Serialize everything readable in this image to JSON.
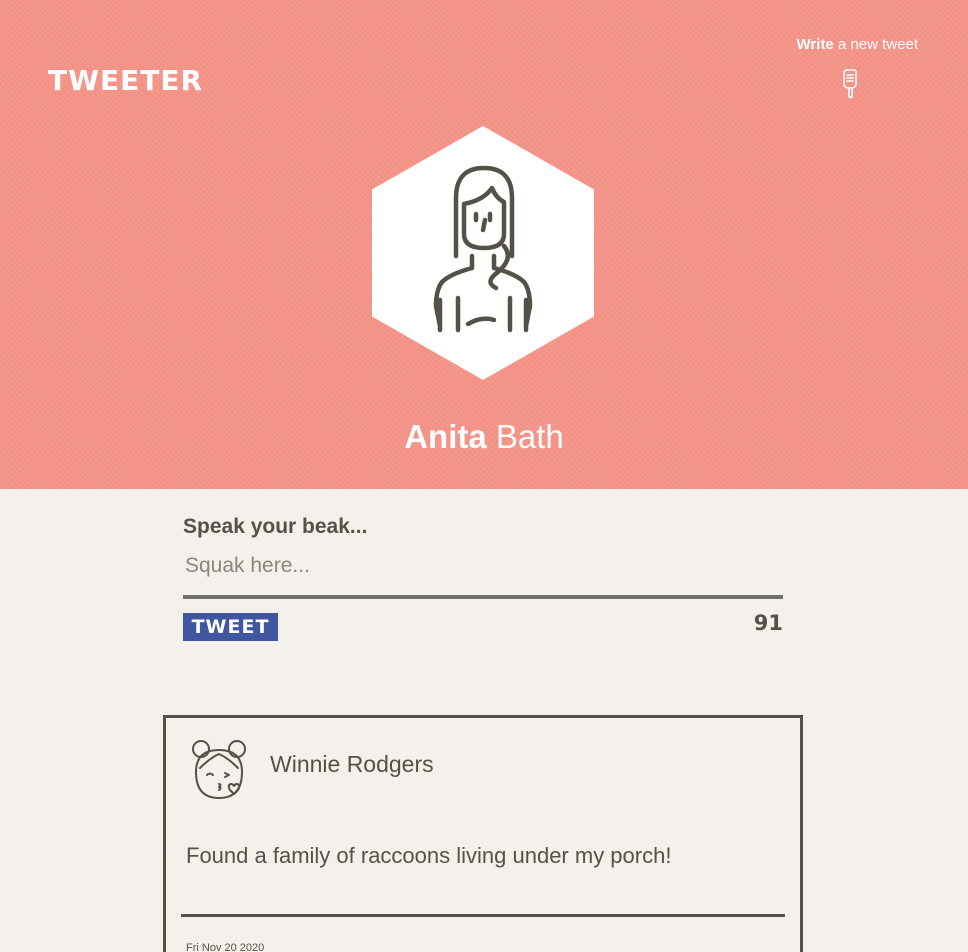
{
  "header": {
    "logo": "TWEETER",
    "compose": {
      "bold": "Write",
      "rest": "a new tweet",
      "icon": "pointing-down-hand-icon"
    },
    "profile": {
      "first_name": "Anita",
      "last_name": "Bath",
      "avatar_icon": "woman-avatar-icon"
    },
    "background_color": "#f39185"
  },
  "composer": {
    "label": "Speak your beak...",
    "placeholder": "Squak here...",
    "value": "",
    "button_label": "TWEET",
    "char_counter": "91",
    "button_color": "#4056a1"
  },
  "tweets": [
    {
      "author": "Winnie Rodgers",
      "avatar_icon": "girl-blowing-kiss-avatar-icon",
      "text": "Found a family of raccoons living under my porch!",
      "date": "Fri Nov 20 2020"
    }
  ],
  "colors": {
    "page_background": "#f4f1ec",
    "text": "#545149"
  }
}
